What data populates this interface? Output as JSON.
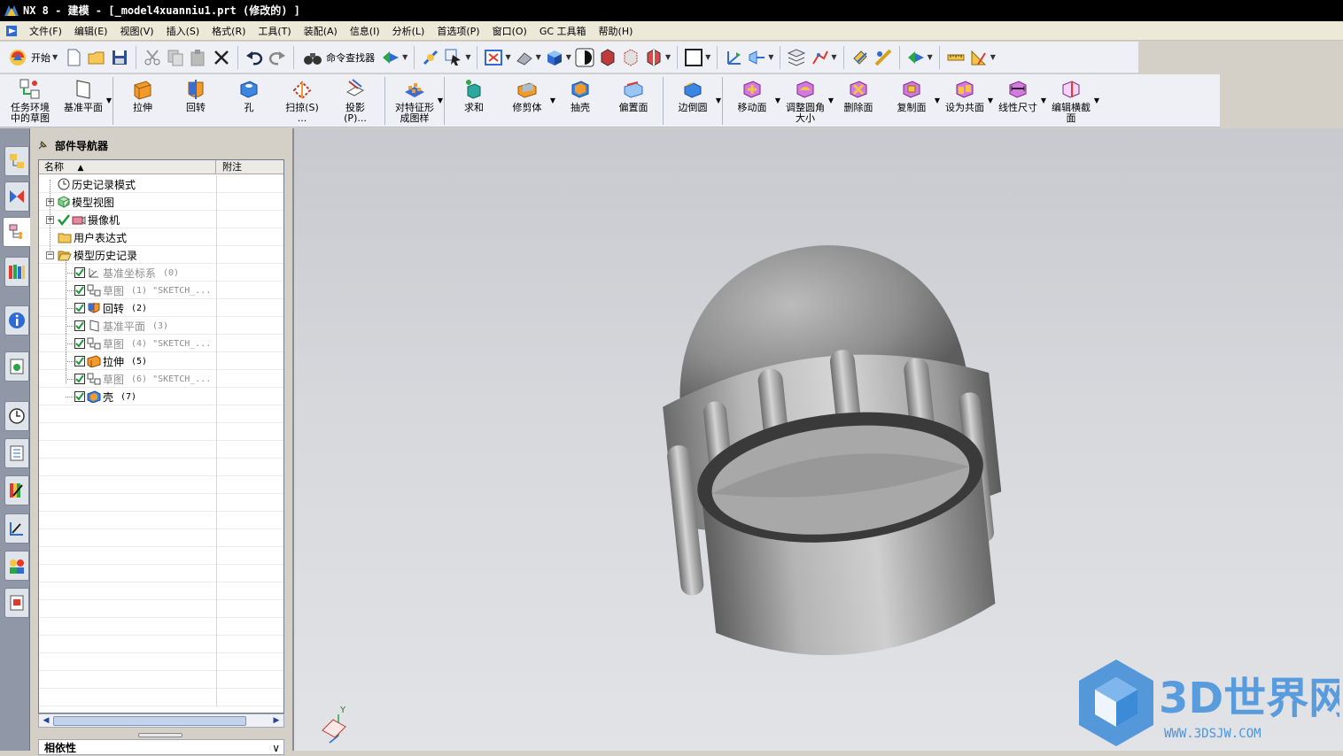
{
  "window": {
    "title": "NX 8 - 建模 - [_model4xuanniu1.prt  (修改的) ]"
  },
  "menu": {
    "items": [
      "文件(F)",
      "编辑(E)",
      "视图(V)",
      "插入(S)",
      "格式(R)",
      "工具(T)",
      "装配(A)",
      "信息(I)",
      "分析(L)",
      "首选项(P)",
      "窗口(O)",
      "GC 工具箱",
      "帮助(H)"
    ]
  },
  "toolbar1": {
    "start_label": "开始",
    "finder_label": "命令查找器"
  },
  "toolbar2": {
    "buttons": [
      {
        "label": "任务环境\n中的草图",
        "icon": "sketch-icon"
      },
      {
        "label": "基准平面",
        "icon": "datum-plane-icon"
      },
      {
        "label": "拉伸",
        "icon": "extrude-icon"
      },
      {
        "label": "回转",
        "icon": "revolve-icon"
      },
      {
        "label": "孔",
        "icon": "hole-icon"
      },
      {
        "label": "扫掠(S)\n...",
        "icon": "sweep-icon"
      },
      {
        "label": "投影\n(P)...",
        "icon": "project-icon"
      },
      {
        "label": "对特征形\n成图样",
        "icon": "pattern-icon"
      },
      {
        "label": "求和",
        "icon": "unite-icon"
      },
      {
        "label": "修剪体",
        "icon": "trim-body-icon"
      },
      {
        "label": "抽壳",
        "icon": "shell-icon"
      },
      {
        "label": "偏置面",
        "icon": "offset-face-icon"
      },
      {
        "label": "边倒圆",
        "icon": "edge-blend-icon"
      },
      {
        "label": "移动面",
        "icon": "move-face-icon"
      },
      {
        "label": "调整圆角\n大小",
        "icon": "resize-blend-icon"
      },
      {
        "label": "删除面",
        "icon": "delete-face-icon"
      },
      {
        "label": "复制面",
        "icon": "copy-face-icon"
      },
      {
        "label": "设为共面",
        "icon": "make-coplanar-icon"
      },
      {
        "label": "线性尺寸",
        "icon": "linear-dimension-icon"
      },
      {
        "label": "编辑横截\n面",
        "icon": "edit-cross-section-icon"
      }
    ]
  },
  "navigator": {
    "title": "部件导航器",
    "col_name": "名称",
    "col_comment": "附注",
    "nodes": [
      {
        "label": "历史记录模式",
        "suffix": "",
        "gray": false
      },
      {
        "label": "模型视图",
        "suffix": "",
        "gray": false
      },
      {
        "label": "摄像机",
        "suffix": "",
        "gray": false
      },
      {
        "label": "用户表达式",
        "suffix": "",
        "gray": false
      },
      {
        "label": "模型历史记录",
        "suffix": "",
        "gray": false
      },
      {
        "label": "基准坐标系",
        "suffix": "(0)",
        "gray": true
      },
      {
        "label": "草图",
        "suffix": "(1) \"SKETCH_...",
        "gray": true
      },
      {
        "label": "回转",
        "suffix": "(2)",
        "gray": false
      },
      {
        "label": "基准平面",
        "suffix": "(3)",
        "gray": true
      },
      {
        "label": "草图",
        "suffix": "(4) \"SKETCH_...",
        "gray": true
      },
      {
        "label": "拉伸",
        "suffix": "(5)",
        "gray": false
      },
      {
        "label": "草图",
        "suffix": "(6) \"SKETCH_...",
        "gray": true
      },
      {
        "label": "壳",
        "suffix": "(7)",
        "gray": false
      }
    ]
  },
  "dependents": {
    "title": "相依性"
  },
  "axis": {
    "y": "Y"
  },
  "watermark": {
    "text": "3D世界网",
    "url": "WWW.3DSJW.COM"
  }
}
